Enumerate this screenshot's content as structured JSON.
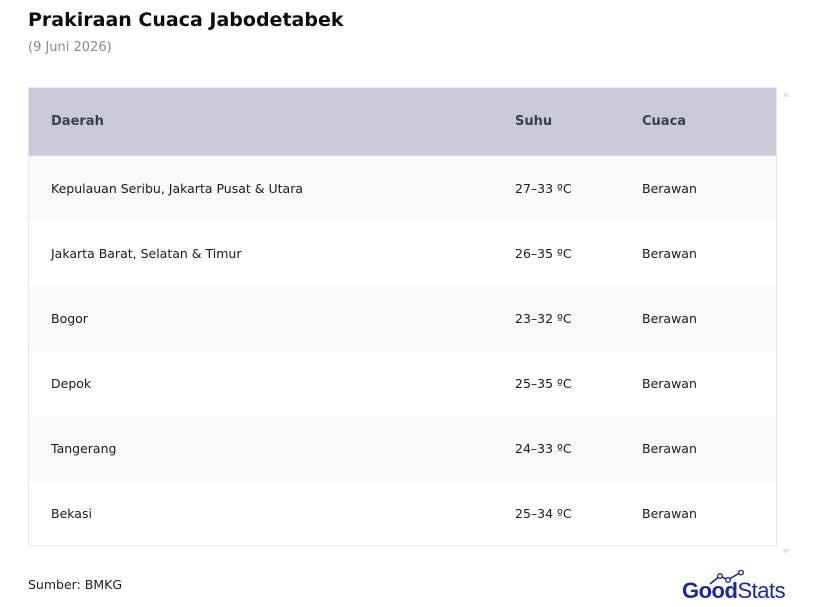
{
  "header": {
    "title": "Prakiraan Cuaca Jabodetabek",
    "subtitle": "(9 Juni 2026)"
  },
  "table": {
    "columns": [
      "Daerah",
      "Suhu",
      "Cuaca"
    ],
    "rows": [
      [
        "Kepulauan Seribu, Jakarta Pusat & Utara",
        "27–33 ºC",
        "Berawan"
      ],
      [
        "Jakarta Barat, Selatan & Timur",
        "26–35 ºC",
        "Berawan"
      ],
      [
        "Bogor",
        "23–32 ºC",
        "Berawan"
      ],
      [
        "Depok",
        "25–35 ºC",
        "Berawan"
      ],
      [
        "Tangerang",
        "24–33 ºC",
        "Berawan"
      ],
      [
        "Bekasi",
        "25–34 ºC",
        "Berawan"
      ]
    ]
  },
  "footer": {
    "source": "Sumber: BMKG",
    "logo_good": "Good",
    "logo_stats": "Stats"
  },
  "colors": {
    "header_bg": "#c8cad7",
    "header_text": "#3a3d4f",
    "stripe": "#f8f9fb",
    "logo": "#1c2b8c"
  },
  "icons": {
    "logo_mark": "trend-line-icon",
    "scroll_up": "scroll-up-arrow-icon",
    "scroll_down": "scroll-down-arrow-icon"
  }
}
